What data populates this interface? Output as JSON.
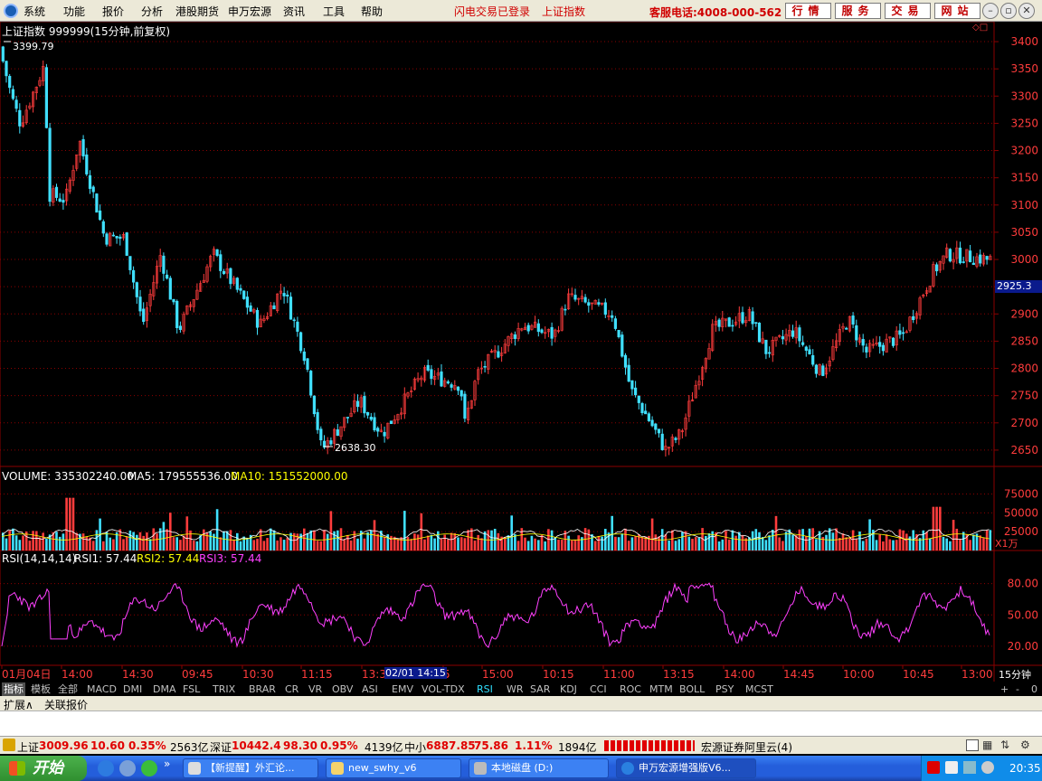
{
  "menu": {
    "items": [
      "系统",
      "功能",
      "报价",
      "分析",
      "港股期货",
      "申万宏源",
      "资讯",
      "工具",
      "帮助"
    ],
    "flash_status": "闪电交易已登录",
    "index_name": "上证指数",
    "hotline": "客服电话:4008-000-562",
    "buttons": [
      "行情",
      "服务",
      "交易",
      "网站"
    ]
  },
  "chart": {
    "title": "上证指数 999999(15分钟,前复权)",
    "price_axis": [
      "3400",
      "3350",
      "3300",
      "3250",
      "3200",
      "3150",
      "3100",
      "3050",
      "3000",
      "2950",
      "2900",
      "2850",
      "2800",
      "2750",
      "2700",
      "2650"
    ],
    "current_price": "2925.3",
    "high_label": "3399.79",
    "low_label": "2638.30",
    "volume_title": "VOLUME: 335302240.00",
    "volume_ma5": "MA5: 179555536.00",
    "volume_ma10": "MA10: 151552000.00",
    "volume_axis": [
      "75000",
      "50000",
      "25000"
    ],
    "volume_unit": "X1万",
    "rsi_title": "RSI(14,14,14)",
    "rsi1": "RSI1: 57.44",
    "rsi2": "RSI2: 57.44",
    "rsi3": "RSI3: 57.44",
    "rsi_axis": [
      "80.00",
      "50.00",
      "20.00"
    ],
    "time_axis": [
      "01月04日",
      "14:00",
      "14:30",
      "09:45",
      "10:30",
      "11:15",
      "13:3",
      "5",
      "15:00",
      "10:15",
      "11:00",
      "13:15",
      "14:00",
      "14:45",
      "10:00",
      "10:45",
      "13:00"
    ],
    "cursor_time": "02/01 14:15",
    "period": "15分钟"
  },
  "tabs": [
    "指标",
    "模板",
    "全部",
    "MACD",
    "DMI",
    "DMA",
    "FSL",
    "TRIX",
    "BRAR",
    "CR",
    "VR",
    "OBV",
    "ASI",
    "EMV",
    "VOL-TDX",
    "RSI",
    "WR",
    "SAR",
    "KDJ",
    "CCI",
    "ROC",
    "MTM",
    "BOLL",
    "PSY",
    "MCST"
  ],
  "tab_controls": [
    "+",
    "-",
    "0"
  ],
  "ext_tabs": [
    "扩展∧",
    "关联报价"
  ],
  "status": {
    "sh_label": "上证",
    "sh_value": "3009.96",
    "sh_change": "10.60",
    "sh_pct": "0.35%",
    "sh_amount": "2563亿",
    "sz_label": "深证",
    "sz_value": "10442.4",
    "sz_change": "98.30",
    "sz_pct": "0.95%",
    "sz_amount": "4139亿",
    "zx_label": "中小",
    "zx_value": "6887.85",
    "zx_change": "75.86",
    "zx_pct": "1.11%",
    "zx_amount": "1894亿",
    "server": "宏源证券阿里云(4)"
  },
  "taskbar": {
    "start": "开始",
    "tasks": [
      "【新提醒】外汇论...",
      "new_swhy_v6",
      "本地磁盘 (D:)",
      "申万宏源增强版V6..."
    ],
    "clock": "20:35"
  },
  "colors": {
    "up": "#ff3c3c",
    "down": "#40e0ff",
    "grid": "#8b0000",
    "ma5": "#ffffff",
    "ma10": "#ffff00",
    "rsi": "#ff40ff"
  }
}
